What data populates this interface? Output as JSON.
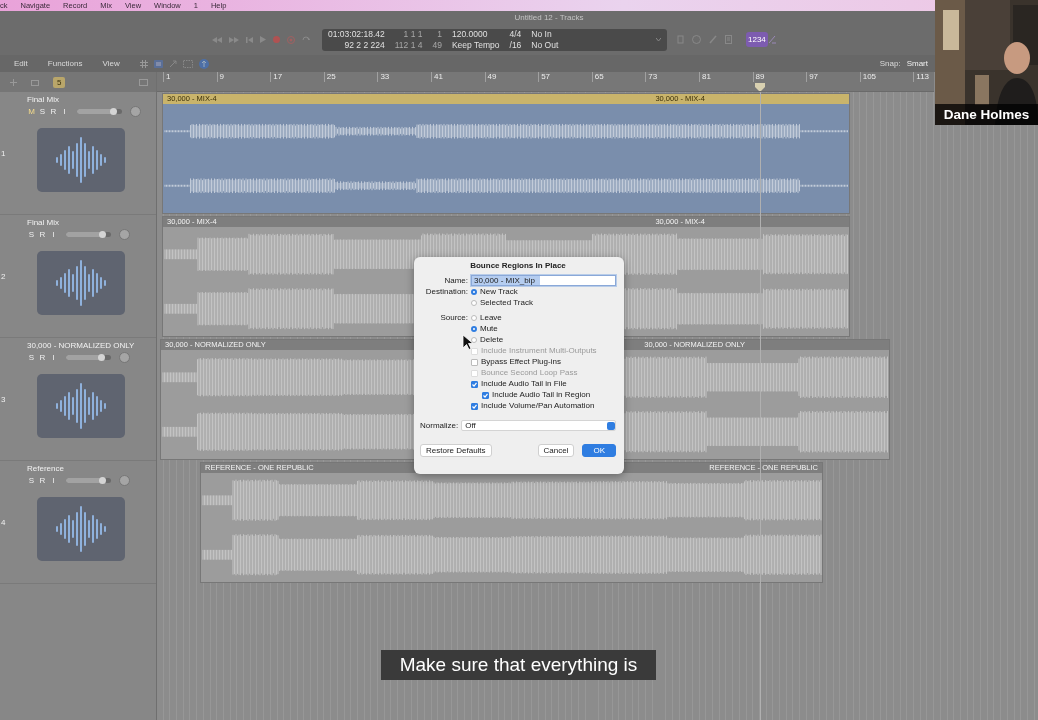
{
  "menu_bar": {
    "items": [
      "ck",
      "Navigate",
      "Record",
      "Mix",
      "View",
      "Window",
      "1",
      "Help"
    ]
  },
  "control_bar": {
    "window_title": "Untitled 12 - Tracks",
    "lcd": {
      "time": "01:03:02:18.42",
      "bars": "92 2 2 224",
      "locator_start": "1 1 1",
      "locator_start_tick": "1",
      "locator_end": "112 1 4",
      "locator_end_tick": "49",
      "tempo": "120.0000",
      "tempo_mode": "Keep Tempo",
      "signature": "4/4",
      "division": "/16",
      "input": "No In",
      "output": "No Out"
    },
    "badge": "1234"
  },
  "toolbar": {
    "menus": [
      "Edit",
      "Functions",
      "View"
    ],
    "snap_label": "Snap:",
    "snap_value": "Smart"
  },
  "track_header_bar": {
    "count_badge": "5"
  },
  "ruler": {
    "marks": [
      "1",
      "9",
      "17",
      "25",
      "33",
      "41",
      "49",
      "57",
      "65",
      "73",
      "81",
      "89",
      "97",
      "105",
      "113"
    ]
  },
  "tracks": [
    {
      "number": "1",
      "name": "Final Mix",
      "buttons": [
        "M",
        "S",
        "R",
        "I"
      ],
      "volume": {
        "level": 0.8
      },
      "region": {
        "selected": true,
        "labels": [
          "30,000 - MIX-4",
          "30,000 - MIX-4"
        ]
      }
    },
    {
      "number": "2",
      "name": "Final Mix",
      "buttons": [
        "S",
        "R",
        "I"
      ],
      "volume": {
        "level": 0.8
      },
      "region": {
        "selected": false,
        "labels": [
          "30,000 - MIX-4",
          "30,000 - MIX-4"
        ]
      }
    },
    {
      "number": "3",
      "name": "30,000 - NORMALIZED ONLY",
      "buttons": [
        "S",
        "R",
        "I"
      ],
      "volume": {
        "level": 0.78
      },
      "region": {
        "selected": false,
        "labels": [
          "30,000 - NORMALIZED ONLY",
          "30,000 - NORMALIZED ONLY"
        ]
      }
    },
    {
      "number": "4",
      "name": "Reference",
      "buttons": [
        "S",
        "R",
        "I"
      ],
      "volume": {
        "level": 0.8
      },
      "region": {
        "selected": false,
        "labels": [
          "REFERENCE - ONE REPUBLIC",
          "REFERENCE - ONE REPUBLIC"
        ]
      }
    }
  ],
  "dialog": {
    "title": "Bounce Regions In Place",
    "name_label": "Name:",
    "name_value": "30,000 - MIX_bip",
    "destination_label": "Destination:",
    "destination_options": [
      {
        "label": "New Track",
        "selected": true
      },
      {
        "label": "Selected Track",
        "selected": false
      }
    ],
    "source_label": "Source:",
    "source_options": [
      {
        "label": "Leave",
        "selected": false
      },
      {
        "label": "Mute",
        "selected": true
      },
      {
        "label": "Delete",
        "selected": false
      }
    ],
    "options": [
      {
        "label": "Include Instrument Multi-Outputs",
        "checked": false,
        "disabled": true
      },
      {
        "label": "Bypass Effect Plug-ins",
        "checked": false,
        "disabled": false
      },
      {
        "label": "Bounce Second Loop Pass",
        "checked": false,
        "disabled": true
      },
      {
        "label": "Include Audio Tail in File",
        "checked": true,
        "disabled": false,
        "children": [
          {
            "label": "Include Audio Tail in Region",
            "checked": true,
            "disabled": false
          }
        ]
      },
      {
        "label": "Include Volume/Pan Automation",
        "checked": true,
        "disabled": false
      }
    ],
    "normalize_label": "Normalize:",
    "normalize_value": "Off",
    "buttons": [
      {
        "label": "Restore Defaults",
        "kind": "secondary"
      },
      {
        "label": "Cancel",
        "kind": "secondary"
      },
      {
        "label": "OK",
        "kind": "default"
      }
    ]
  },
  "video": {
    "kind": "picture",
    "participant": "Dane Holmes"
  },
  "caption": "Make sure that everything is"
}
